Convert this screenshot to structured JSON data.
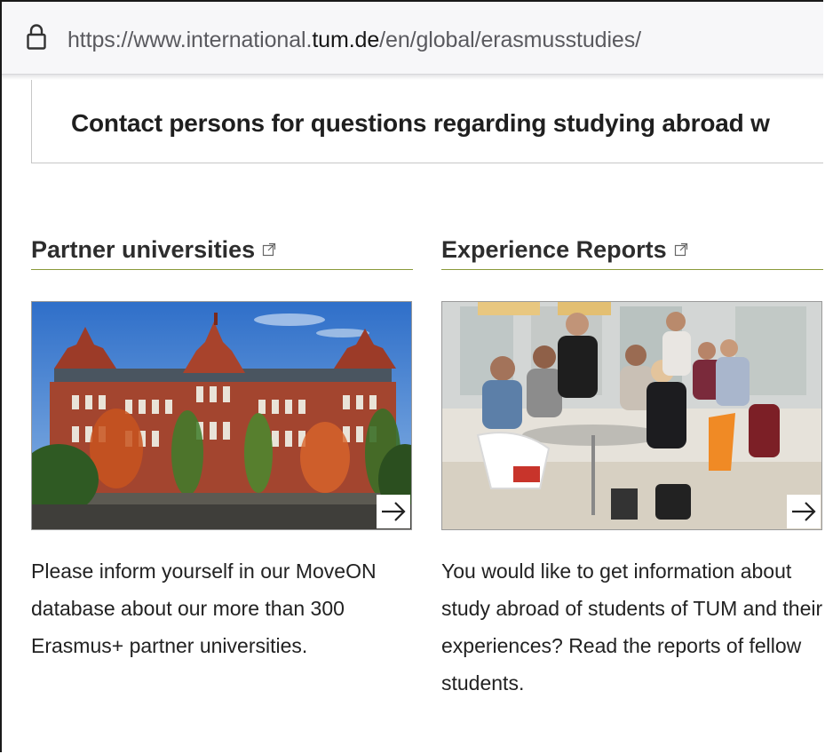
{
  "browser": {
    "url_prefix": "https://www.international.",
    "url_host": "tum.de",
    "url_path": "/en/global/erasmusstudies/"
  },
  "page": {
    "contact_heading": "Contact persons for questions regarding studying abroad w"
  },
  "cards": [
    {
      "title": "Partner universities",
      "description": "Please inform yourself in our MoveON database about our more than 300 Erasmus+ partner universities."
    },
    {
      "title": "Experience Reports",
      "description": "You would like to get information about study abroad of students of TUM and their experiences? Read the reports of fellow students."
    }
  ],
  "colors": {
    "title_underline": "#8a9a3a",
    "heading_text": "#2d2d2d"
  }
}
